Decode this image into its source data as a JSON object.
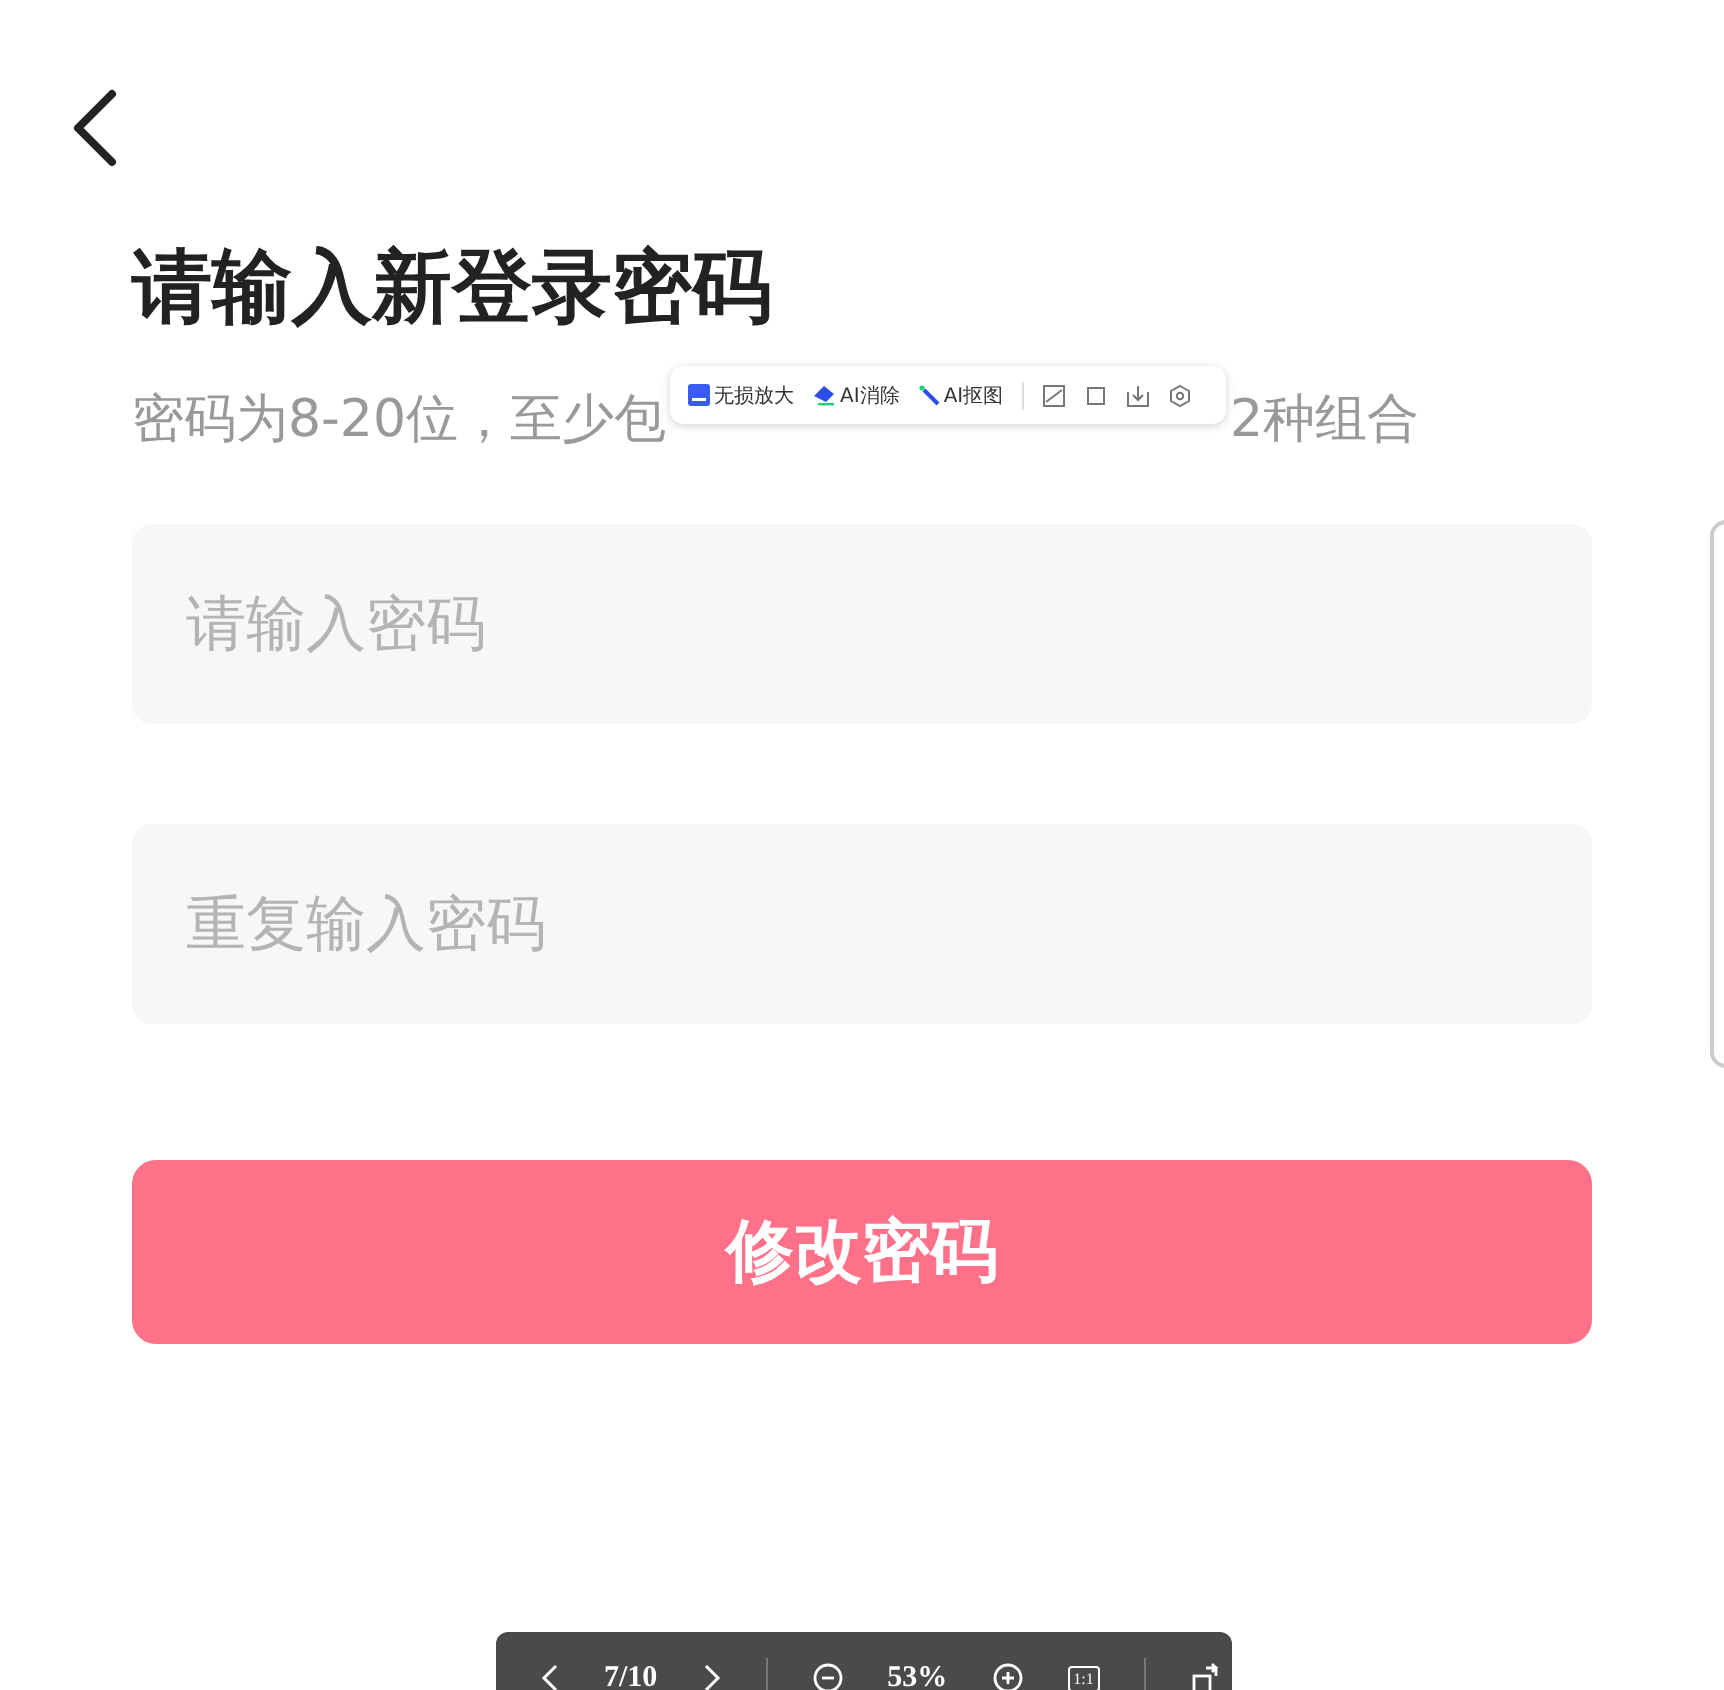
{
  "page": {
    "title": "请输入新登录密码",
    "subtitle_parts": [
      "密码为8-20位，至少包",
      "2种组合"
    ]
  },
  "fields": [
    {
      "placeholder": "请输入密码"
    },
    {
      "placeholder": "重复输入密码"
    }
  ],
  "submit_button": "修改密码",
  "image_toolbar": {
    "actions": [
      "无损放大",
      "AI消除",
      "AI抠图"
    ]
  },
  "viewer_bar": {
    "page_counter": "7/10",
    "zoom": "53%",
    "actual_size": "1:1"
  }
}
